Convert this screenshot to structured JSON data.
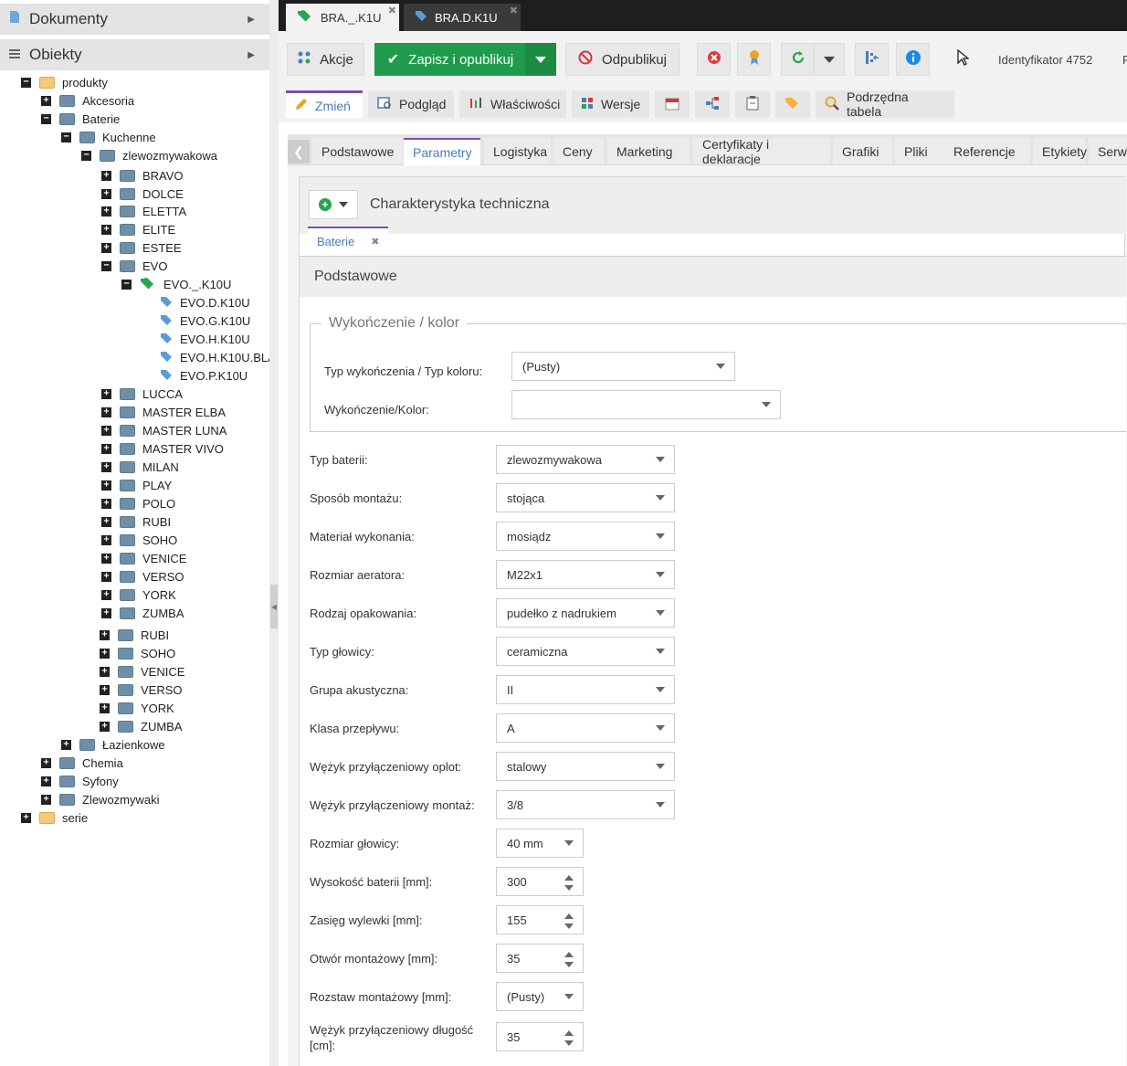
{
  "sidebar": {
    "documents_label": "Dokumenty",
    "objects_label": "Obiekty",
    "tree": [
      {
        "label": "produkty",
        "indent": 0,
        "toggle": "minus",
        "icon": "folder-yellow"
      },
      {
        "label": "Akcesoria",
        "indent": 1,
        "toggle": "plus",
        "icon": "folder-gray"
      },
      {
        "label": "Baterie",
        "indent": 1,
        "toggle": "minus",
        "icon": "folder-gray"
      },
      {
        "label": "Kuchenne",
        "indent": 2,
        "toggle": "minus",
        "icon": "folder-gray"
      },
      {
        "label": "zlewozmywakowa",
        "indent": 3,
        "toggle": "minus",
        "icon": "folder-gray"
      },
      {
        "label": "BRAVO",
        "indent": 4,
        "toggle": "plus",
        "icon": "folder-gray"
      },
      {
        "label": "DOLCE",
        "indent": 4,
        "toggle": "plus",
        "icon": "folder-gray"
      },
      {
        "label": "ELETTA",
        "indent": 4,
        "toggle": "plus",
        "icon": "folder-gray"
      },
      {
        "label": "ELITE",
        "indent": 4,
        "toggle": "plus",
        "icon": "folder-gray"
      },
      {
        "label": "ESTEE",
        "indent": 4,
        "toggle": "plus",
        "icon": "folder-gray"
      },
      {
        "label": "EVO",
        "indent": 4,
        "toggle": "minus",
        "icon": "folder-gray"
      },
      {
        "label": "EVO._.K10U",
        "indent": 5,
        "toggle": "minus",
        "icon": "tags-green"
      },
      {
        "label": "EVO.D.K10U",
        "indent": 6,
        "toggle": "none",
        "icon": "tag-blue"
      },
      {
        "label": "EVO.G.K10U",
        "indent": 6,
        "toggle": "none",
        "icon": "tag-blue"
      },
      {
        "label": "EVO.H.K10U",
        "indent": 6,
        "toggle": "none",
        "icon": "tag-blue"
      },
      {
        "label": "EVO.H.K10U.BLA",
        "indent": 6,
        "toggle": "none",
        "icon": "tag-blue"
      },
      {
        "label": "EVO.P.K10U",
        "indent": 6,
        "toggle": "none",
        "icon": "tag-blue"
      },
      {
        "label": "LUCCA",
        "indent": 4,
        "toggle": "plus",
        "icon": "folder-gray"
      },
      {
        "label": "MASTER ELBA",
        "indent": 4,
        "toggle": "plus",
        "icon": "folder-gray"
      },
      {
        "label": "MASTER LUNA",
        "indent": 4,
        "toggle": "plus",
        "icon": "folder-gray"
      },
      {
        "label": "MASTER VIVO",
        "indent": 4,
        "toggle": "plus",
        "icon": "folder-gray"
      },
      {
        "label": "MILAN",
        "indent": 4,
        "toggle": "plus",
        "icon": "folder-gray"
      },
      {
        "label": "PLAY",
        "indent": 4,
        "toggle": "plus",
        "icon": "folder-gray"
      },
      {
        "label": "POLO",
        "indent": 4,
        "toggle": "plus",
        "icon": "folder-gray"
      },
      {
        "label": "RUBI",
        "indent": 4,
        "toggle": "plus",
        "icon": "folder-gray"
      },
      {
        "label": "SOHO",
        "indent": 4,
        "toggle": "plus",
        "icon": "folder-gray"
      },
      {
        "label": "VENICE",
        "indent": 4,
        "toggle": "plus",
        "icon": "folder-gray"
      },
      {
        "label": "VERSO",
        "indent": 4,
        "toggle": "plus",
        "icon": "folder-gray"
      },
      {
        "label": "YORK",
        "indent": 4,
        "toggle": "plus",
        "icon": "folder-gray"
      },
      {
        "label": "ZUMBA",
        "indent": 4,
        "toggle": "plus",
        "icon": "folder-gray"
      },
      {
        "label": "RUBI",
        "indent": 3.9,
        "toggle": "plus",
        "icon": "folder-gray"
      },
      {
        "label": "SOHO",
        "indent": 3.9,
        "toggle": "plus",
        "icon": "folder-gray"
      },
      {
        "label": "VENICE",
        "indent": 3.9,
        "toggle": "plus",
        "icon": "folder-gray"
      },
      {
        "label": "VERSO",
        "indent": 3.9,
        "toggle": "plus",
        "icon": "folder-gray"
      },
      {
        "label": "YORK",
        "indent": 3.9,
        "toggle": "plus",
        "icon": "folder-gray"
      },
      {
        "label": "ZUMBA",
        "indent": 3.9,
        "toggle": "plus",
        "icon": "folder-gray"
      },
      {
        "label": "Łazienkowe",
        "indent": 2,
        "toggle": "plus",
        "icon": "folder-gray"
      },
      {
        "label": "Chemia",
        "indent": 1,
        "toggle": "plus",
        "icon": "folder-gray"
      },
      {
        "label": "Syfony",
        "indent": 1,
        "toggle": "plus",
        "icon": "folder-gray"
      },
      {
        "label": "Zlewozmywaki",
        "indent": 1,
        "toggle": "plus",
        "icon": "folder-gray"
      },
      {
        "label": "serie",
        "indent": 0,
        "toggle": "plus",
        "icon": "folder-yellow"
      }
    ]
  },
  "doc_tabs": [
    {
      "label": "BRA._.K1U",
      "icon": "tags-green",
      "active": true
    },
    {
      "label": "BRA.D.K1U",
      "icon": "tag-blue",
      "active": false
    }
  ],
  "toolbar": {
    "actions_label": "Akcje",
    "save_publish_label": "Zapisz i opublikuj",
    "unpublish_label": "Odpublikuj",
    "identifier_label": "Identyfikator 4752",
    "trailing_label": "P"
  },
  "subtabs": [
    "Zmień",
    "Podgląd",
    "Właściwości",
    "Wersje",
    "",
    "",
    "",
    "",
    "Podrzędna tabela"
  ],
  "main_tabs": [
    "Podstawowe",
    "Parametry",
    "Logistyka",
    "Ceny",
    "Marketing",
    "Certyfikaty i deklaracje",
    "Grafiki",
    "Pliki",
    "Referencje",
    "Etykiety",
    "Serwis"
  ],
  "panel": {
    "title": "Charakterystyka techniczna",
    "inner_tab": "Baterie",
    "section_title": "Podstawowe",
    "fieldset_legend": "Wykończenie / kolor",
    "finish_fields": [
      {
        "label": "Typ wykończenia / Typ koloru:",
        "value": "(Pusty)"
      },
      {
        "label": "Wykończenie/Kolor:",
        "value": ""
      }
    ],
    "fields": [
      {
        "label": "Typ baterii:",
        "value": "zlewozmywakowa",
        "kind": "select"
      },
      {
        "label": "Sposób montażu:",
        "value": "stojąca",
        "kind": "select"
      },
      {
        "label": "Materiał wykonania:",
        "value": "mosiądz",
        "kind": "select"
      },
      {
        "label": "Rozmiar aeratora:",
        "value": "M22x1",
        "kind": "select"
      },
      {
        "label": "Rodzaj opakowania:",
        "value": "pudełko z nadrukiem",
        "kind": "select"
      },
      {
        "label": "Typ głowicy:",
        "value": "ceramiczna",
        "kind": "select"
      },
      {
        "label": "Grupa akustyczna:",
        "value": "II",
        "kind": "select"
      },
      {
        "label": "Klasa przepływu:",
        "value": "A",
        "kind": "select"
      },
      {
        "label": "Wężyk przyłączeniowy oplot:",
        "value": "stalowy",
        "kind": "select"
      },
      {
        "label": "Wężyk przyłączeniowy montaż:",
        "value": "3/8",
        "kind": "select"
      },
      {
        "label": "Rozmiar głowicy:",
        "value": "40 mm",
        "kind": "select-small"
      },
      {
        "label": "Wysokość baterii [mm]:",
        "value": "300",
        "kind": "spinner"
      },
      {
        "label": "Zasięg wylewki [mm]:",
        "value": "155",
        "kind": "spinner"
      },
      {
        "label": "Otwór montażowy [mm]:",
        "value": "35",
        "kind": "spinner"
      },
      {
        "label": "Rozstaw montażowy [mm]:",
        "value": "(Pusty)",
        "kind": "select-small"
      },
      {
        "label": "Wężyk przyłączeniowy długość [cm]:",
        "value": "35",
        "kind": "spinner"
      }
    ]
  },
  "colors": {
    "accent": "#7c4fb5",
    "save_green": "#1f9c4b",
    "link_blue": "#4a7db8"
  }
}
